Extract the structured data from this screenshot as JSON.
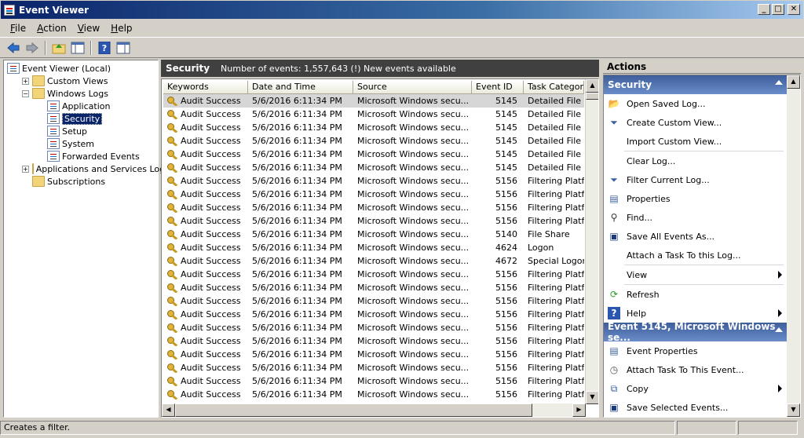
{
  "window": {
    "title": "Event Viewer"
  },
  "menu": [
    "File",
    "Action",
    "View",
    "Help"
  ],
  "menu_underline": [
    "F",
    "A",
    "V",
    "H"
  ],
  "tree": [
    {
      "label": "Event Viewer (Local)",
      "level": 0,
      "exp": "",
      "icon": "event-viewer-icon"
    },
    {
      "label": "Custom Views",
      "level": 1,
      "exp": "+",
      "icon": "folder-icon"
    },
    {
      "label": "Windows Logs",
      "level": 1,
      "exp": "−",
      "icon": "folder-icon"
    },
    {
      "label": "Application",
      "level": 2,
      "exp": "",
      "icon": "log-icon"
    },
    {
      "label": "Security",
      "level": 2,
      "exp": "",
      "icon": "log-icon",
      "selected": true
    },
    {
      "label": "Setup",
      "level": 2,
      "exp": "",
      "icon": "log-icon"
    },
    {
      "label": "System",
      "level": 2,
      "exp": "",
      "icon": "log-icon"
    },
    {
      "label": "Forwarded Events",
      "level": 2,
      "exp": "",
      "icon": "log-icon"
    },
    {
      "label": "Applications and Services Logs",
      "level": 1,
      "exp": "+",
      "icon": "folder-icon"
    },
    {
      "label": "Subscriptions",
      "level": 1,
      "exp": "",
      "icon": "folder-icon"
    }
  ],
  "log_header": {
    "name": "Security",
    "info": "Number of events: 1,557,643 (!) New events available"
  },
  "columns": [
    "Keywords",
    "Date and Time",
    "Source",
    "Event ID",
    "Task Category"
  ],
  "events": [
    [
      "Audit Success",
      "5/6/2016 6:11:34 PM",
      "Microsoft Windows secu...",
      "5145",
      "Detailed File Share"
    ],
    [
      "Audit Success",
      "5/6/2016 6:11:34 PM",
      "Microsoft Windows secu...",
      "5145",
      "Detailed File Share"
    ],
    [
      "Audit Success",
      "5/6/2016 6:11:34 PM",
      "Microsoft Windows secu...",
      "5145",
      "Detailed File Share"
    ],
    [
      "Audit Success",
      "5/6/2016 6:11:34 PM",
      "Microsoft Windows secu...",
      "5145",
      "Detailed File Share"
    ],
    [
      "Audit Success",
      "5/6/2016 6:11:34 PM",
      "Microsoft Windows secu...",
      "5145",
      "Detailed File Share"
    ],
    [
      "Audit Success",
      "5/6/2016 6:11:34 PM",
      "Microsoft Windows secu...",
      "5145",
      "Detailed File Share"
    ],
    [
      "Audit Success",
      "5/6/2016 6:11:34 PM",
      "Microsoft Windows secu...",
      "5156",
      "Filtering Platform"
    ],
    [
      "Audit Success",
      "5/6/2016 6:11:34 PM",
      "Microsoft Windows secu...",
      "5156",
      "Filtering Platform"
    ],
    [
      "Audit Success",
      "5/6/2016 6:11:34 PM",
      "Microsoft Windows secu...",
      "5156",
      "Filtering Platform"
    ],
    [
      "Audit Success",
      "5/6/2016 6:11:34 PM",
      "Microsoft Windows secu...",
      "5156",
      "Filtering Platform"
    ],
    [
      "Audit Success",
      "5/6/2016 6:11:34 PM",
      "Microsoft Windows secu...",
      "5140",
      "File Share"
    ],
    [
      "Audit Success",
      "5/6/2016 6:11:34 PM",
      "Microsoft Windows secu...",
      "4624",
      "Logon"
    ],
    [
      "Audit Success",
      "5/6/2016 6:11:34 PM",
      "Microsoft Windows secu...",
      "4672",
      "Special Logon"
    ],
    [
      "Audit Success",
      "5/6/2016 6:11:34 PM",
      "Microsoft Windows secu...",
      "5156",
      "Filtering Platform"
    ],
    [
      "Audit Success",
      "5/6/2016 6:11:34 PM",
      "Microsoft Windows secu...",
      "5156",
      "Filtering Platform"
    ],
    [
      "Audit Success",
      "5/6/2016 6:11:34 PM",
      "Microsoft Windows secu...",
      "5156",
      "Filtering Platform"
    ],
    [
      "Audit Success",
      "5/6/2016 6:11:34 PM",
      "Microsoft Windows secu...",
      "5156",
      "Filtering Platform"
    ],
    [
      "Audit Success",
      "5/6/2016 6:11:34 PM",
      "Microsoft Windows secu...",
      "5156",
      "Filtering Platform"
    ],
    [
      "Audit Success",
      "5/6/2016 6:11:34 PM",
      "Microsoft Windows secu...",
      "5156",
      "Filtering Platform"
    ],
    [
      "Audit Success",
      "5/6/2016 6:11:34 PM",
      "Microsoft Windows secu...",
      "5156",
      "Filtering Platform"
    ],
    [
      "Audit Success",
      "5/6/2016 6:11:34 PM",
      "Microsoft Windows secu...",
      "5156",
      "Filtering Platform"
    ],
    [
      "Audit Success",
      "5/6/2016 6:11:34 PM",
      "Microsoft Windows secu...",
      "5156",
      "Filtering Platform"
    ],
    [
      "Audit Success",
      "5/6/2016 6:11:34 PM",
      "Microsoft Windows secu...",
      "5156",
      "Filtering Platform"
    ]
  ],
  "actions": {
    "title": "Actions",
    "sections": [
      {
        "header": "Security",
        "items": [
          {
            "label": "Open Saved Log...",
            "icon": "open-folder-icon"
          },
          {
            "label": "Create Custom View...",
            "icon": "funnel-add-icon"
          },
          {
            "label": "Import Custom View...",
            "icon": ""
          },
          {
            "sep": true
          },
          {
            "label": "Clear Log...",
            "icon": ""
          },
          {
            "label": "Filter Current Log...",
            "icon": "funnel-icon"
          },
          {
            "label": "Properties",
            "icon": "properties-icon"
          },
          {
            "label": "Find...",
            "icon": "binoculars-icon"
          },
          {
            "label": "Save All Events As...",
            "icon": "save-icon"
          },
          {
            "label": "Attach a Task To this Log...",
            "icon": ""
          },
          {
            "sep": true
          },
          {
            "label": "View",
            "icon": "",
            "submenu": true
          },
          {
            "sep": true
          },
          {
            "label": "Refresh",
            "icon": "refresh-icon"
          },
          {
            "label": "Help",
            "icon": "help-icon",
            "submenu": true
          }
        ]
      },
      {
        "header": "Event 5145, Microsoft Windows se...",
        "items": [
          {
            "label": "Event Properties",
            "icon": "properties-icon"
          },
          {
            "label": "Attach Task To This Event...",
            "icon": "clock-icon"
          },
          {
            "label": "Copy",
            "icon": "copy-icon",
            "submenu": true
          },
          {
            "label": "Save Selected Events...",
            "icon": "save-icon"
          }
        ]
      }
    ]
  },
  "status": {
    "text": "Creates a filter."
  },
  "colors": {
    "title_bar": "#0a246a",
    "selection": "#0a246a",
    "action_header": "#3d5d9b",
    "log_header": "#404040"
  }
}
